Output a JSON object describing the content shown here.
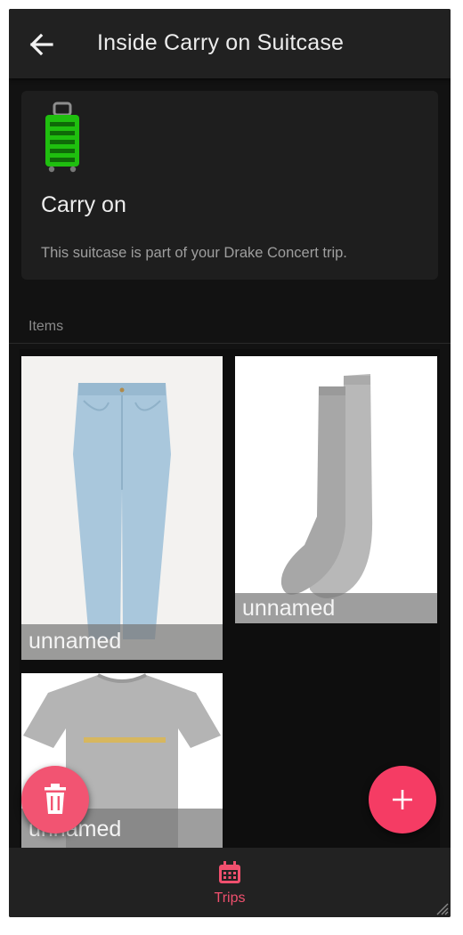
{
  "appbar": {
    "title": "Inside Carry on Suitcase",
    "back_icon": "arrow-left-icon"
  },
  "suitcase": {
    "name": "Carry on",
    "description": "This suitcase is part of your Drake Concert trip.",
    "icon": "suitcase-icon",
    "icon_color": "#1fbf0f"
  },
  "items_section": {
    "label": "Items"
  },
  "items": [
    {
      "name": "unnamed",
      "image": "jeans"
    },
    {
      "name": "unnamed",
      "image": "socks"
    },
    {
      "name": "unnamed",
      "image": "t-shirt"
    }
  ],
  "fabs": {
    "delete_icon": "trash-icon",
    "add_icon": "plus-icon"
  },
  "bottom_nav": {
    "items": [
      {
        "label": "Trips",
        "icon": "calendar-icon"
      }
    ]
  },
  "colors": {
    "accent": "#f53c64",
    "background": "#121212",
    "appbar": "#212121"
  }
}
